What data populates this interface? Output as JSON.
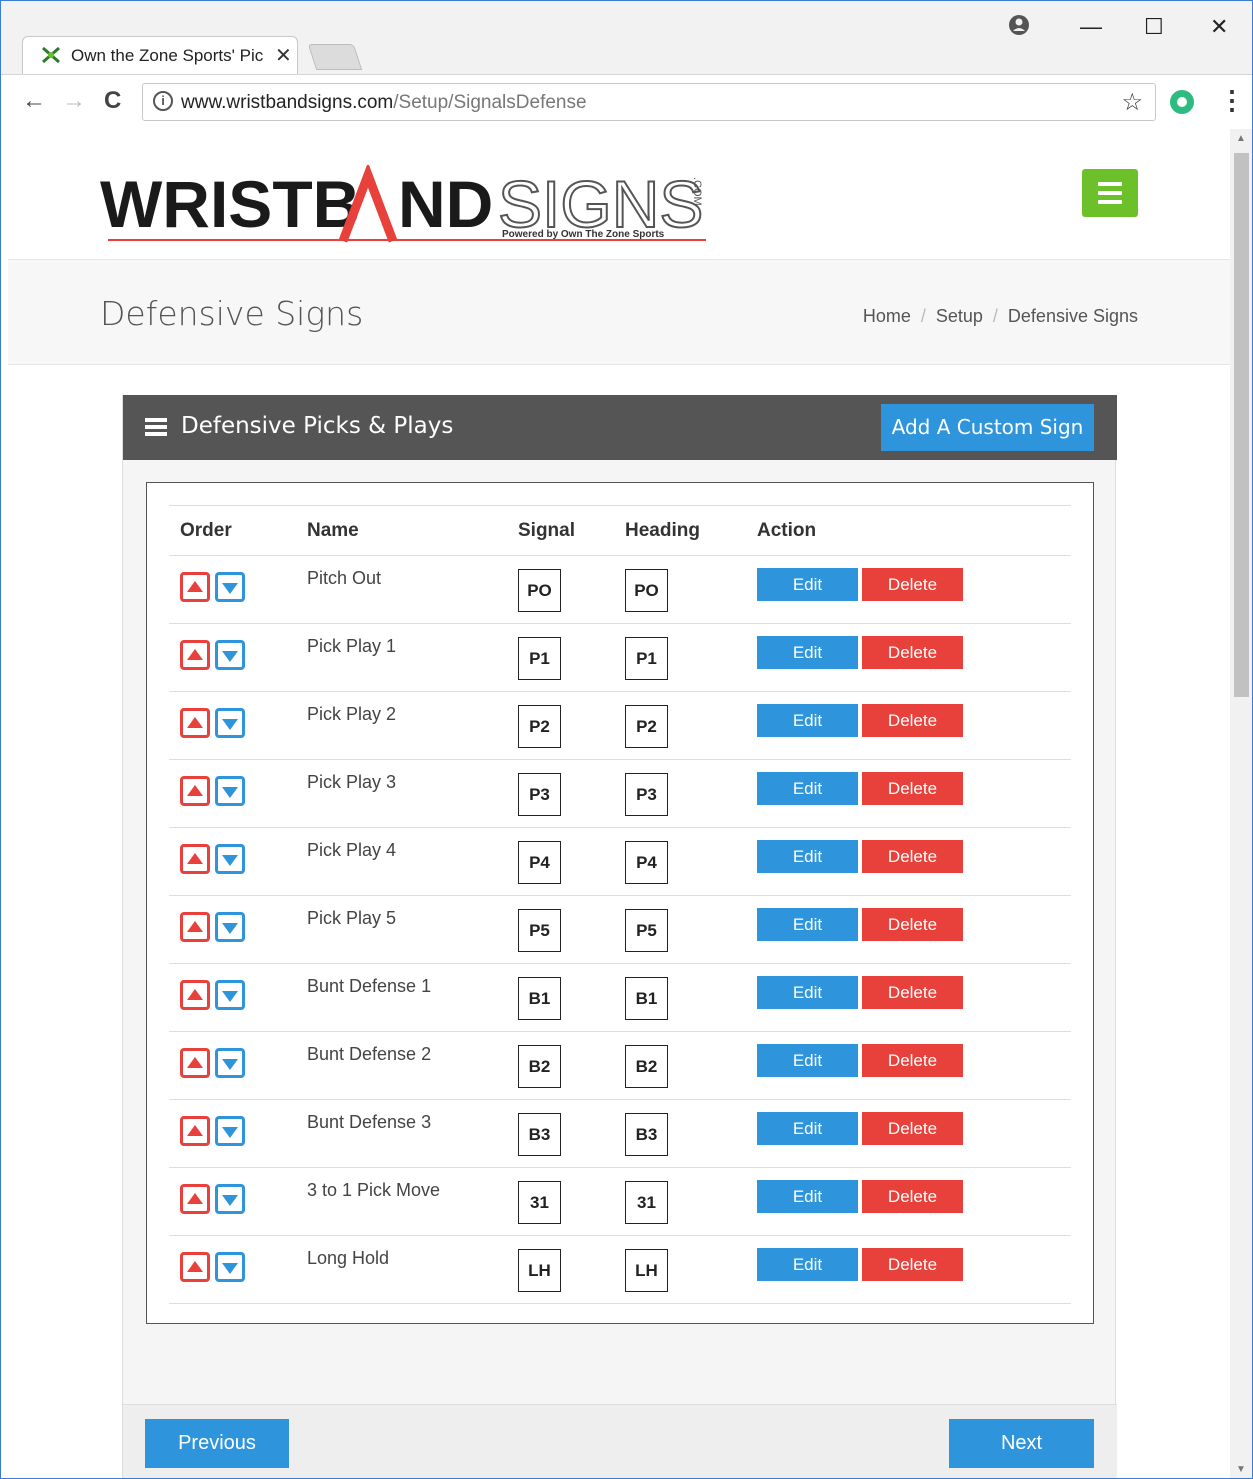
{
  "browser": {
    "tab_title": "Own the Zone Sports' Pic",
    "url_host": "www.wristbandsigns.com",
    "url_path": "/Setup/SignalsDefense",
    "window_min": "—",
    "window_max": "☐",
    "window_close": "✕",
    "tab_close": "✕",
    "back": "←",
    "forward": "→",
    "reload": "C",
    "star": "☆",
    "menu": "⋮",
    "info": "i"
  },
  "site": {
    "logo_text_dark": "WRISTB",
    "logo_text_dark2": "ND",
    "logo_text_outline": "SIGNS",
    "logo_dotcom": ".COM",
    "logo_tagline": "Powered by Own The Zone Sports",
    "colors": {
      "brand_red": "#e8403b",
      "brand_blue": "#2e95dd",
      "brand_green": "#6cc12a"
    }
  },
  "page": {
    "title": "Defensive Signs",
    "breadcrumb": [
      "Home",
      "Setup",
      "Defensive Signs"
    ],
    "breadcrumb_sep": "/"
  },
  "panel": {
    "title": "Defensive Picks & Plays",
    "add_button": "Add A Custom Sign",
    "columns": {
      "order": "Order",
      "name": "Name",
      "signal": "Signal",
      "heading": "Heading",
      "action": "Action"
    },
    "rows": [
      {
        "name": "Pitch Out",
        "signal": "PO",
        "heading": "PO"
      },
      {
        "name": "Pick Play 1",
        "signal": "P1",
        "heading": "P1"
      },
      {
        "name": "Pick Play 2",
        "signal": "P2",
        "heading": "P2"
      },
      {
        "name": "Pick Play 3",
        "signal": "P3",
        "heading": "P3"
      },
      {
        "name": "Pick Play 4",
        "signal": "P4",
        "heading": "P4"
      },
      {
        "name": "Pick Play 5",
        "signal": "P5",
        "heading": "P5"
      },
      {
        "name": "Bunt Defense 1",
        "signal": "B1",
        "heading": "B1"
      },
      {
        "name": "Bunt Defense 2",
        "signal": "B2",
        "heading": "B2"
      },
      {
        "name": "Bunt Defense 3",
        "signal": "B3",
        "heading": "B3"
      },
      {
        "name": "3 to 1 Pick Move",
        "signal": "31",
        "heading": "31"
      },
      {
        "name": "Long Hold",
        "signal": "LH",
        "heading": "LH"
      }
    ],
    "edit_label": "Edit",
    "delete_label": "Delete",
    "previous_label": "Previous",
    "next_label": "Next"
  }
}
